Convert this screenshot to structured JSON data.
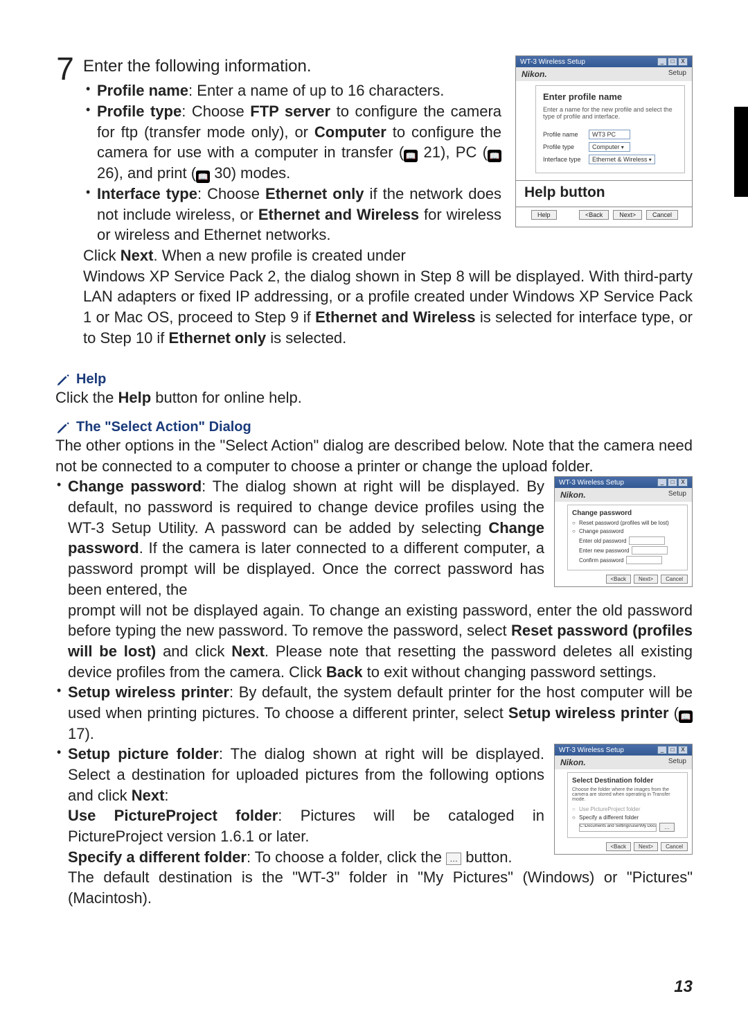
{
  "step": {
    "number": "7",
    "title": "Enter the following information.",
    "bullet1_a": "Profile name",
    "bullet1_b": ": Enter a name of up to 16 characters.",
    "bullet2_a": "Profile type",
    "bullet2_b": ": Choose ",
    "bullet2_c": "FTP server",
    "bullet2_d": " to configure the camera for ftp (transfer mode only), or ",
    "bullet2_e": "Computer",
    "bullet2_f": " to configure the camera for use with a computer in transfer (",
    "bullet2_ref1": "21",
    "bullet2_g": "), PC (",
    "bullet2_ref2": "26",
    "bullet2_h": "), and print (",
    "bullet2_ref3": "30",
    "bullet2_i": ") modes.",
    "bullet3_a": "Interface type",
    "bullet3_b": ": Choose ",
    "bullet3_c": "Ethernet only",
    "bullet3_d": " if the network does not include wireless, or ",
    "bullet3_e": "Ethernet and Wireless",
    "bullet3_f": " for wireless or wireless and Ethernet networks.",
    "after_a": "Click ",
    "after_b": "Next",
    "after_c": ".  When a new profile is created under Windows XP Service Pack 2, the dialog shown in Step 8 will be displayed.  With third-party LAN adapters or fixed IP addressing, or a profile created under Windows XP Service Pack 1 or Mac OS, proceed to Step 9 if ",
    "after_d": "Ethernet and Wireless",
    "after_e": " is selected for interface type, or to Step 10 if ",
    "after_f": "Ethernet only",
    "after_g": " is selected."
  },
  "help_note": {
    "heading": "Help",
    "body_a": "Click the ",
    "body_b": "Help",
    "body_c": " button for online help."
  },
  "select_note": {
    "heading": "The \"Select Action\" Dialog",
    "intro": "The other options in the \"Select Action\" dialog are described below.  Note that the camera need not be connected to a computer to choose a printer or change the upload folder.",
    "b1_a": "Change password",
    "b1_b": ": The dialog shown at right will be displayed.  By default, no password is required to change device profiles using the WT-3 Setup Utility.  A password can be added by selecting ",
    "b1_c": "Change password",
    "b1_d": ".  If the camera is later connected to a different computer, a password prompt will be displayed.  Once the correct password has been entered, the ",
    "b1_e": "prompt will not be displayed again.  To change an existing password, enter the old password before typing the new password.  To remove the password, select ",
    "b1_f": "Reset password (profiles will be lost)",
    "b1_g": " and click ",
    "b1_h": "Next",
    "b1_i": ".  Please note that resetting the password deletes all existing device profiles from the camera.  Click ",
    "b1_j": "Back",
    "b1_k": " to exit without changing password settings.",
    "b2_a": "Setup wireless printer",
    "b2_b": ": By default, the system default printer for the host computer will be used when printing pictures.  To choose a different printer, select ",
    "b2_c": "Setup wireless printer",
    "b2_d": " (",
    "b2_ref": "17",
    "b2_e": ").",
    "b3_a": "Setup picture folder",
    "b3_b": ": The dialog shown at right will be displayed.  Select a destination for uploaded pictures from the following options and click ",
    "b3_c": "Next",
    "b3_d": ":",
    "b3_e": "Use PictureProject folder",
    "b3_f": ": Pictures will be cataloged in PictureProject version 1.6.1 or later.",
    "b3_g": "Specify a different folder",
    "b3_h": ": To choose a folder, click the ",
    "b3_i": " button.",
    "b3_j": "The default destination is the \"WT-3\" folder in \"My Pictures\" (Windows) or \"Pictures\" (Macintosh)."
  },
  "shot1": {
    "window_title": "WT-3 Wireless Setup",
    "brand": "Nikon.",
    "setup": "Setup",
    "heading": "Enter profile name",
    "sub": "Enter a name for the new profile and select the type of profile and interface.",
    "f1_label": "Profile name",
    "f1_value": "WT3 PC",
    "f2_label": "Profile type",
    "f2_value": "Computer",
    "f3_label": "Interface type",
    "f3_value": "Ethernet & Wireless",
    "help_label": "Help button",
    "btn_help": "Help",
    "btn_back": "<Back",
    "btn_next": "Next>",
    "btn_cancel": "Cancel"
  },
  "shot2": {
    "window_title": "WT-3 Wireless Setup",
    "brand": "Nikon.",
    "setup": "Setup",
    "heading": "Change password",
    "opt1": "Reset password (profiles will be lost)",
    "opt2": "Change password",
    "fld1": "Enter old password",
    "fld2": "Enter new password",
    "fld3": "Confirm password",
    "btn_back": "<Back",
    "btn_next": "Next>",
    "btn_cancel": "Cancel"
  },
  "shot3": {
    "window_title": "WT-3 Wireless Setup",
    "brand": "Nikon.",
    "setup": "Setup",
    "heading": "Select Destination folder",
    "sub": "Choose the folder where the images from the camera are stored when operating in Transfer mode.",
    "opt1": "Use PictureProject folder",
    "opt2": "Specify a different folder",
    "path": "C:\\Documents and Settings\\user\\My Documents\\My Pictures",
    "btn_back": "<Back",
    "btn_next": "Next>",
    "btn_cancel": "Cancel"
  },
  "page_number": "13"
}
